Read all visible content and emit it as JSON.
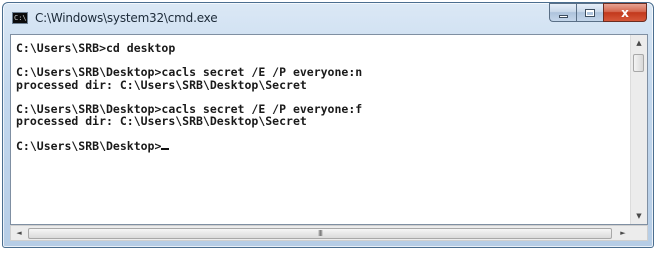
{
  "window": {
    "title": "C:\\Windows\\system32\\cmd.exe",
    "icon": "cmd-icon",
    "icon_text": "C:\\"
  },
  "controls": {
    "minimize_icon": "minimize-icon",
    "maximize_icon": "maximize-icon",
    "close_icon": "close-icon",
    "close_glyph": "x"
  },
  "console": {
    "lines": [
      "C:\\Users\\SRB>cd desktop",
      "",
      "C:\\Users\\SRB\\Desktop>cacls secret /E /P everyone:n",
      "processed dir: C:\\Users\\SRB\\Desktop\\Secret",
      "",
      "C:\\Users\\SRB\\Desktop>cacls secret /E /P everyone:f",
      "processed dir: C:\\Users\\SRB\\Desktop\\Secret",
      "",
      "C:\\Users\\SRB\\Desktop>"
    ],
    "text_color": "#1a1a1a",
    "background": "#ffffff"
  },
  "scrollbars": {
    "up_arrow": "▲",
    "down_arrow": "▼",
    "left_arrow": "◄",
    "right_arrow": "►",
    "thumb_grip": "III"
  }
}
